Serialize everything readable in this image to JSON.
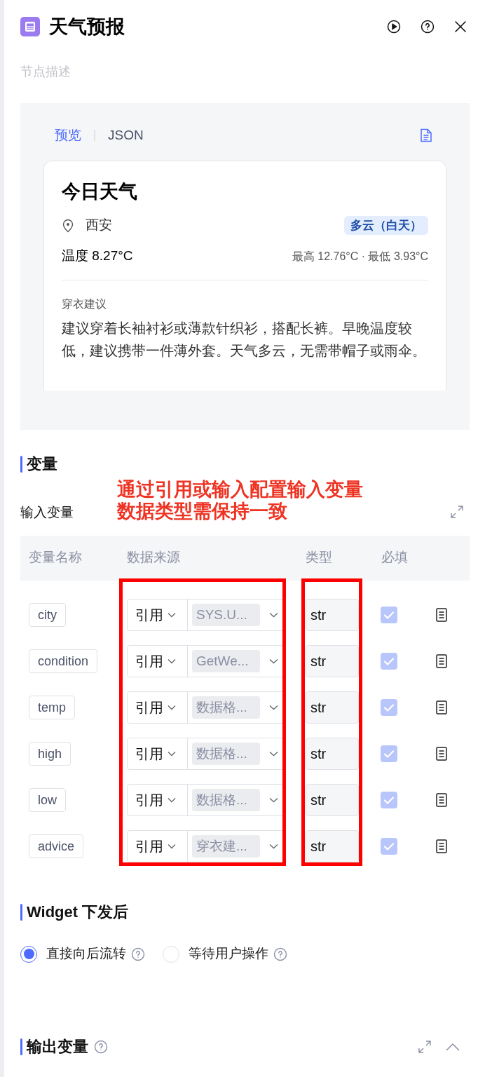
{
  "header": {
    "title": "天气预报",
    "description_placeholder": "节点描述"
  },
  "preview": {
    "tabs": [
      {
        "label": "预览",
        "selected": true
      },
      {
        "label": "JSON",
        "selected": false
      }
    ],
    "card": {
      "title": "今日天气",
      "location": "西安",
      "condition": "多云（白天）",
      "temperature": "温度 8.27°C",
      "range": "最高 12.76°C · 最低 3.93°C",
      "advice_label": "穿衣建议",
      "advice": "建议穿着长袖衬衫或薄款针织衫，搭配长裤。早晚温度较低，建议携带一件薄外套。天气多云，无需带帽子或雨伞。"
    }
  },
  "variables": {
    "heading": "变量",
    "input_label": "输入变量",
    "annotation": [
      "通过引用或输入配置输入变量",
      "数据类型需保持一致"
    ],
    "columns": [
      "变量名称",
      "数据来源",
      "类型",
      "必填"
    ],
    "rows": [
      {
        "name": "city",
        "source_mode": "引用",
        "reference": "SYS.U...",
        "type": "str",
        "required": true
      },
      {
        "name": "condition",
        "source_mode": "引用",
        "reference": "GetWe...",
        "type": "str",
        "required": true
      },
      {
        "name": "temp",
        "source_mode": "引用",
        "reference": "数据格...",
        "type": "str",
        "required": true
      },
      {
        "name": "high",
        "source_mode": "引用",
        "reference": "数据格...",
        "type": "str",
        "required": true
      },
      {
        "name": "low",
        "source_mode": "引用",
        "reference": "数据格...",
        "type": "str",
        "required": true
      },
      {
        "name": "advice",
        "source_mode": "引用",
        "reference": "穿衣建...",
        "type": "str",
        "required": true
      }
    ]
  },
  "widget": {
    "heading": "Widget 下发后",
    "options": [
      {
        "label": "直接向后流转",
        "selected": true
      },
      {
        "label": "等待用户操作",
        "selected": false
      }
    ]
  },
  "output": {
    "heading": "输出变量",
    "expanded": true
  }
}
